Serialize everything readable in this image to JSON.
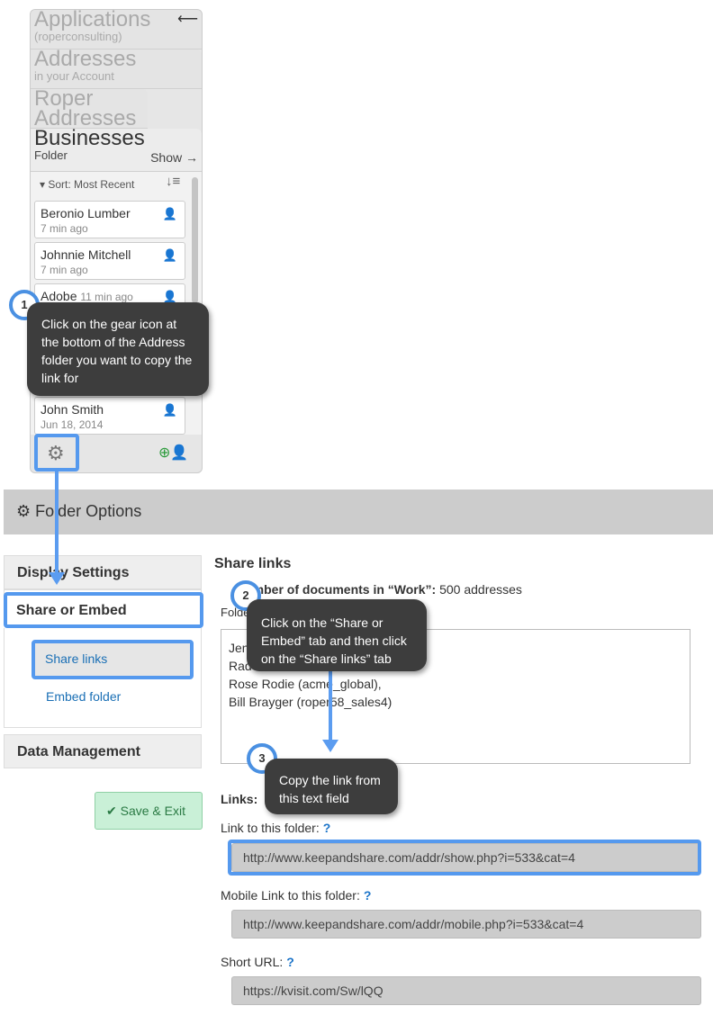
{
  "sidebar": {
    "crumbs": [
      {
        "title": "Applications",
        "sub": "(roperconsulting)"
      },
      {
        "title": "Addresses",
        "sub": "in your Account"
      },
      {
        "title": "Roper Addresses",
        "sub": ""
      }
    ],
    "current": {
      "title": "Businesses",
      "sub": "Folder",
      "show": "Show →"
    },
    "back_icon": "arrow-left-icon",
    "sort_label": "Sort: Most Recent",
    "items": [
      {
        "name": "Beronio Lumber",
        "time": "7 min ago"
      },
      {
        "name": "Johnnie Mitchell",
        "time": "7 min ago"
      },
      {
        "name": "Adobe",
        "time": "11 min ago"
      },
      {
        "name": "John Smith",
        "time": "Jun 18, 2014"
      }
    ]
  },
  "header": {
    "title": "Folder Options"
  },
  "tabs": {
    "display": "Display Settings",
    "share": "Share or Embed",
    "share_links": "Share links",
    "embed": "Embed folder",
    "data": "Data Management"
  },
  "save_label": "Save & Exit",
  "main": {
    "title": "Share links",
    "docs_label": "Number of documents in “Work”:",
    "docs_value": " 500 addresses",
    "folder_label": "Folder",
    "users": [
      "Jen",
      "Rad",
      "Rose Rodie (acme_global),",
      "Bill Brayger (roper58_sales4)"
    ],
    "links_label": "Links:",
    "link_label": "Link to this folder:",
    "link": "http://www.keepandshare.com/addr/show.php?i=533&cat=4",
    "mobile_label": "Mobile Link to this folder:",
    "mobile": "http://www.keepandshare.com/addr/mobile.php?i=533&cat=4",
    "short_label": "Short URL:",
    "short": "https://kvisit.com/Sw/lQQ",
    "help": "?"
  },
  "callouts": [
    {
      "n": "1",
      "text": "Click on the gear icon at the bottom of the Address folder you want to copy the link for"
    },
    {
      "n": "2",
      "text": "Click on the “Share or Embed” tab and then click on the “Share links” tab"
    },
    {
      "n": "3",
      "text": "Copy the link from this text field"
    }
  ],
  "colors": {
    "highlight": "#5599ee",
    "callout": "#3d3d3d",
    "save": "#c9f0d7"
  }
}
